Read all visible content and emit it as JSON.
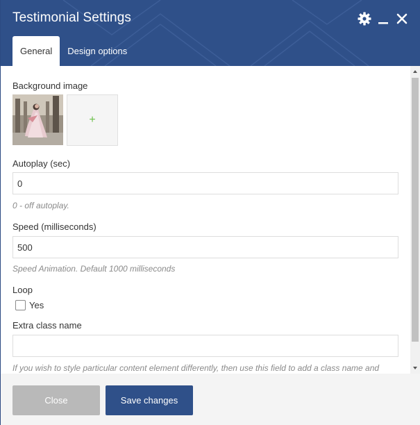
{
  "header": {
    "title": "Testimonial Settings",
    "tabs": [
      {
        "label": "General",
        "active": true
      },
      {
        "label": "Design options",
        "active": false
      }
    ],
    "icons": [
      "gear-icon",
      "minimize-icon",
      "close-icon"
    ]
  },
  "form": {
    "background_image": {
      "label": "Background image",
      "add_symbol": "+"
    },
    "autoplay": {
      "label": "Autoplay (sec)",
      "value": "0",
      "help": "0 - off autoplay."
    },
    "speed": {
      "label": "Speed (milliseconds)",
      "value": "500",
      "help": "Speed Animation. Default 1000 milliseconds"
    },
    "loop": {
      "label": "Loop",
      "option_label": "Yes",
      "checked": false
    },
    "extra_class": {
      "label": "Extra class name",
      "value": "",
      "help": "If you wish to style particular content element differently, then use this field to add a class name and"
    }
  },
  "footer": {
    "close_label": "Close",
    "save_label": "Save changes"
  },
  "colors": {
    "header_bg": "#2f5089",
    "save_button": "#2f5089",
    "close_button": "#b9b9b9",
    "add_plus": "#6cc04a"
  }
}
